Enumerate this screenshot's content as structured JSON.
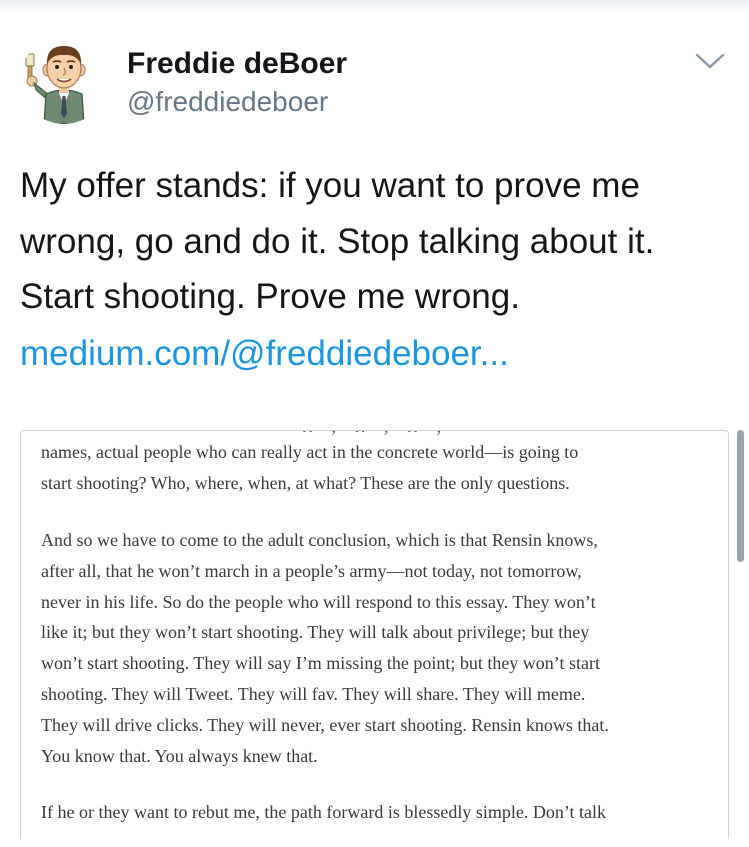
{
  "tweet": {
    "author": {
      "display_name": "Freddie deBoer",
      "handle": "@freddiedeboer"
    },
    "text": "My offer stands: if you want to prove me wrong, go and do it. Stop talking about it. Start shooting. Prove me wrong.",
    "link_text": "medium.com/@freddiedeboer...",
    "menu_icon": "chevron-down-icon"
  },
  "media": {
    "paragraphs": [
      {
        "lines": [
          "names, actual people who can really act in the concrete world—is going to",
          "start shooting? Who, where, when, at what? These are the only questions."
        ]
      },
      {
        "lines": [
          "And so we have to come to the adult conclusion, which is that Rensin knows,",
          "after all, that he won’t march in a people’s army—not today, not tomorrow,",
          "never in his life. So do the people who will respond to this essay. They won’t",
          "like it; but they won’t start shooting. They will talk about privilege; but they",
          "won’t start shooting. They will say I’m missing the point; but they won’t start",
          "shooting. They will Tweet. They will fav. They will share. They will meme.",
          "They will drive clicks. They will never, ever start shooting. Rensin knows that.",
          "You know that. You always knew that."
        ]
      },
      {
        "lines": [
          "If he or they want to rebut me, the path forward is blessedly simple. Don’t talk"
        ]
      }
    ]
  },
  "colors": {
    "text": "#14171a",
    "secondary": "#657786",
    "link": "#1b95e0",
    "border": "#ccd6dd",
    "article_text": "#3a3a3a"
  }
}
